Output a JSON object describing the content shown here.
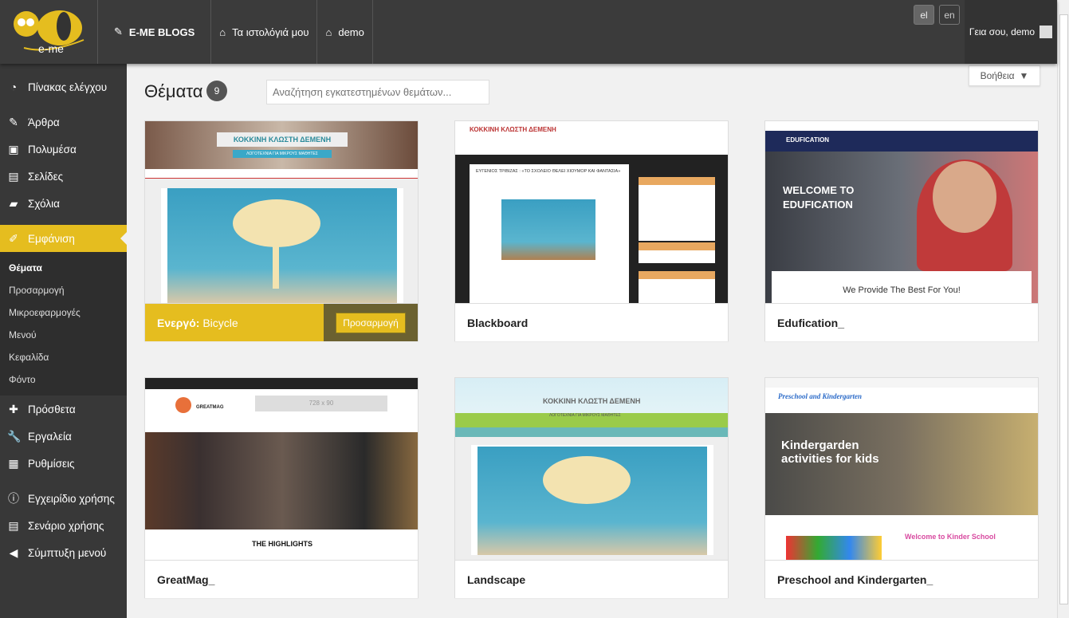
{
  "topbar": {
    "logo_text": "e-me",
    "blogs_label": "E-ME BLOGS",
    "my_blogs_label": "Τα ιστολόγιά μου",
    "site_label": "demo",
    "langs": [
      "el",
      "en"
    ],
    "greeting": "Γεια σου, demo"
  },
  "sidebar": {
    "items": [
      {
        "label": "Πίνακας ελέγχου",
        "icon": "dashboard-icon"
      },
      {
        "label": "Άρθρα",
        "icon": "pin-icon"
      },
      {
        "label": "Πολυμέσα",
        "icon": "media-icon"
      },
      {
        "label": "Σελίδες",
        "icon": "pages-icon"
      },
      {
        "label": "Σχόλια",
        "icon": "comment-icon"
      },
      {
        "label": "Εμφάνιση",
        "icon": "brush-icon"
      },
      {
        "label": "Πρόσθετα",
        "icon": "plugin-icon"
      },
      {
        "label": "Εργαλεία",
        "icon": "wrench-icon"
      },
      {
        "label": "Ρυθμίσεις",
        "icon": "settings-icon"
      },
      {
        "label": "Εγχειρίδιο χρήσης",
        "icon": "info-icon"
      },
      {
        "label": "Σενάριο χρήσης",
        "icon": "document-icon"
      },
      {
        "label": "Σύμπτυξη μενού",
        "icon": "collapse-icon"
      }
    ],
    "submenu": [
      "Θέματα",
      "Προσαρμογή",
      "Μικροεφαρμογές",
      "Μενού",
      "Κεφαλίδα",
      "Φόντο"
    ]
  },
  "page": {
    "title": "Θέματα",
    "count": "9",
    "search_placeholder": "Αναζήτηση εγκατεστημένων θεμάτων...",
    "help_label": "Βοήθεια"
  },
  "themes": [
    {
      "name": "Bicycle",
      "active": true,
      "active_prefix": "Ενεργό:",
      "customize_label": "Προσαρμογή",
      "preview_title": "ΚΟΚΚΙΝΗ ΚΛΩΣΤΗ ΔΕΜΕΝΗ",
      "preview_subtitle": "ΛΟΓΟΤΕΧΝΙΑ ΓΙΑ ΜΙΚΡΟΥΣ ΜΑΘΗΤΕΣ"
    },
    {
      "name": "Blackboard",
      "preview_title": "ΚΟΚΚΙΝΗ ΚΛΩΣΤΗ ΔΕΜΕΝΗ",
      "preview_post": "ΕΥΓΕΝΙΟΣ ΤΡΙΒΙΖΑΣ : «ΤΟ ΣΧΟΛΕΙΟ ΘΕΛΕΙ ΧΙΟΥΜΟΡ ΚΑΙ ΦΑΝΤΑΣΙΑ»"
    },
    {
      "name": "Edufication_",
      "preview_title": "WELCOME TO EDUFICATION",
      "preview_tagline": "We Provide The Best For You!",
      "preview_logo": "EDUFICATION"
    },
    {
      "name": "GreatMag_",
      "preview_logo": "GREATMAG",
      "preview_ad": "728 x 90",
      "preview_heading": "THE HIGHLIGHTS"
    },
    {
      "name": "Landscape",
      "preview_title": "ΚΟΚΚΙΝΗ ΚΛΩΣΤΗ ΔΕΜΕΝΗ",
      "preview_subtitle": "ΛΟΓΟΤΕΧΝΙΑ ΓΙΑ ΜΙΚΡΟΥΣ ΜΑΘΗΤΕΣ"
    },
    {
      "name": "Preschool and Kindergarten_",
      "preview_logo": "Preschool and Kindergarten",
      "preview_title": "Kindergarden activities for kids",
      "preview_welcome": "Welcome to Kinder School"
    }
  ],
  "colors": {
    "accent": "#e5bd1f",
    "sidebar": "#383838",
    "topbar": "#3b3b3b"
  }
}
